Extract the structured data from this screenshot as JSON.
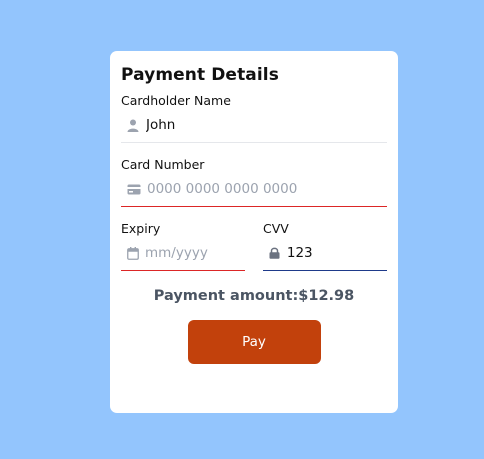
{
  "form": {
    "title": "Payment Details",
    "cardholder": {
      "label": "Cardholder Name",
      "value": "John",
      "icon": "user-icon"
    },
    "card_number": {
      "label": "Card Number",
      "placeholder": "0000 0000 0000 0000",
      "icon": "credit-card-icon"
    },
    "expiry": {
      "label": "Expiry",
      "placeholder": "mm/yyyy",
      "icon": "calendar-icon"
    },
    "cvv": {
      "label": "CVV",
      "value": "123",
      "icon": "lock-icon"
    },
    "amount_text": "Payment amount:$12.98",
    "pay_label": "Pay"
  },
  "colors": {
    "background": "#93c5fd",
    "card": "#ffffff",
    "accent_button": "#c2410c",
    "error_border": "#dc2626",
    "active_border": "#1e3a8a",
    "muted_text": "#4b5563",
    "placeholder": "#9ca3af"
  }
}
